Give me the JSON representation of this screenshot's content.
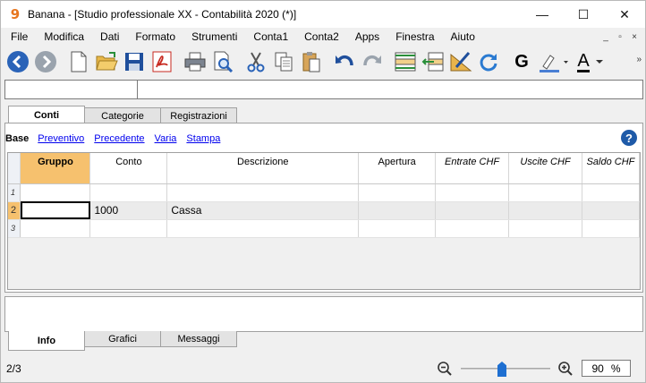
{
  "window": {
    "title": "Banana - [Studio professionale XX - Contabilità 2020 (*)]",
    "logo_glyph": "9",
    "controls": {
      "minimize": "—",
      "maximize": "☐",
      "close": "✕"
    }
  },
  "menu": [
    "File",
    "Modifica",
    "Dati",
    "Formato",
    "Strumenti",
    "Conta1",
    "Conta2",
    "Apps",
    "Finestra",
    "Aiuto"
  ],
  "mdi_controls": {
    "minimize": "_",
    "restore": "▫",
    "close": "×"
  },
  "toolbar": {
    "buttons": [
      "back-icon",
      "forward-icon",
      "new-file-icon",
      "open-folder-icon",
      "save-icon",
      "pdf-icon",
      "print-icon",
      "print-preview-icon",
      "cut-icon",
      "copy-icon",
      "paste-icon",
      "undo-icon",
      "redo-icon",
      "insert-row-icon",
      "delete-row-icon",
      "edit-ruler-icon",
      "refresh-icon",
      "bold-icon",
      "highlight-icon",
      "font-color-icon"
    ],
    "bold_label": "G",
    "font_color_label": "A",
    "accent_blue": "#1e6fd1",
    "highlight_color": "#4a7fd4",
    "font_color_bar": "#111111"
  },
  "tabs": [
    "Conti",
    "Categorie",
    "Registrazioni"
  ],
  "active_tab": "Conti",
  "views": {
    "base": "Base",
    "links": [
      "Preventivo",
      "Precedente",
      "Varia",
      "Stampa"
    ],
    "help": "?"
  },
  "table": {
    "columns": [
      "Gruppo",
      "Conto",
      "Descrizione",
      "Apertura",
      "Entrate CHF",
      "Uscite CHF",
      "Saldo CHF"
    ],
    "rows": [
      {
        "num": "1",
        "gruppo": "",
        "conto": "",
        "descrizione": "",
        "apertura": "",
        "entrate": "",
        "uscite": "",
        "saldo": ""
      },
      {
        "num": "2",
        "gruppo": "",
        "conto": "1000",
        "descrizione": "Cassa",
        "apertura": "",
        "entrate": "",
        "uscite": "",
        "saldo": ""
      },
      {
        "num": "3",
        "gruppo": "",
        "conto": "",
        "descrizione": "",
        "apertura": "",
        "entrate": "",
        "uscite": "",
        "saldo": ""
      }
    ],
    "header_highlight": "#f6c16e"
  },
  "bottom_tabs": [
    "Info",
    "Grafici",
    "Messaggi"
  ],
  "active_bottom_tab": "Info",
  "status": {
    "position": "2/3",
    "zoom_value": "90",
    "zoom_unit": "%",
    "zoom_fraction": 0.45
  }
}
